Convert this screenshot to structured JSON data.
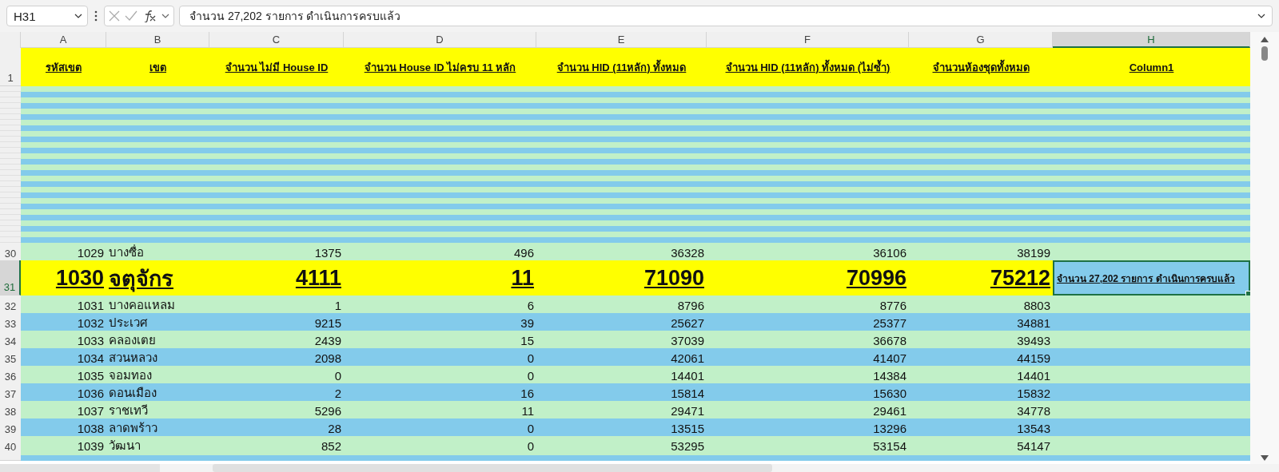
{
  "formula_bar": {
    "name_box": "H31",
    "formula": "จำนวน 27,202 รายการ ดำเนินการครบแล้ว"
  },
  "columns": [
    {
      "label": "A",
      "selected": false
    },
    {
      "label": "B",
      "selected": false
    },
    {
      "label": "C",
      "selected": false
    },
    {
      "label": "D",
      "selected": false
    },
    {
      "label": "E",
      "selected": false
    },
    {
      "label": "F",
      "selected": false
    },
    {
      "label": "G",
      "selected": false
    },
    {
      "label": "H",
      "selected": true
    }
  ],
  "header_row": {
    "number": "1",
    "color": "#ffff00",
    "cells": [
      "รหัสเขต",
      "เขต",
      "จำนวน ไม่มี House ID",
      "จำนวน House ID ไม่ครบ 11 หลัก",
      "จำนวน HID (11หลัก) ทั้งหมด",
      "จำนวน HID (11หลัก) ทั้งหมด (ไม่ซ้ำ)",
      "จำนวนห้องชุดทั้งหมด",
      "Column1"
    ]
  },
  "compressed_rows": [
    {
      "color": "#c1f0c8"
    },
    {
      "color": "#83cbeb"
    },
    {
      "color": "#c1f0c8"
    },
    {
      "color": "#83cbeb"
    },
    {
      "color": "#c1f0c8"
    },
    {
      "color": "#83cbeb"
    },
    {
      "color": "#c1f0c8"
    },
    {
      "color": "#83cbeb"
    },
    {
      "color": "#c1f0c8"
    },
    {
      "color": "#83cbeb"
    },
    {
      "color": "#c1f0c8"
    },
    {
      "color": "#83cbeb"
    },
    {
      "color": "#c1f0c8"
    },
    {
      "color": "#83cbeb"
    },
    {
      "color": "#c1f0c8"
    },
    {
      "color": "#83cbeb"
    },
    {
      "color": "#c1f0c8"
    },
    {
      "color": "#83cbeb"
    },
    {
      "color": "#c1f0c8"
    },
    {
      "color": "#83cbeb"
    },
    {
      "color": "#c1f0c8"
    },
    {
      "color": "#83cbeb"
    },
    {
      "color": "#c1f0c8"
    },
    {
      "color": "#83cbeb"
    },
    {
      "color": "#c1f0c8"
    },
    {
      "color": "#83cbeb"
    },
    {
      "color": "#c1f0c8"
    },
    {
      "color": "#83cbeb"
    }
  ],
  "rows": [
    {
      "number": "30",
      "kind": "normal",
      "selected": false,
      "color": "#c1f0c8",
      "cells": [
        "1029",
        "บางซื่อ",
        "1375",
        "496",
        "36328",
        "36106",
        "38199",
        ""
      ]
    },
    {
      "number": "31",
      "kind": "highlight",
      "selected": true,
      "color": "#ffff00",
      "cells": [
        "1030",
        "จตุจักร",
        "4111",
        "11",
        "71090",
        "70996",
        "75212",
        "จำนวน 27,202 รายการ ดำเนินการครบแล้ว"
      ]
    },
    {
      "number": "32",
      "kind": "normal",
      "selected": false,
      "color": "#c1f0c8",
      "cells": [
        "1031",
        "บางคอแหลม",
        "1",
        "6",
        "8796",
        "8776",
        "8803",
        ""
      ]
    },
    {
      "number": "33",
      "kind": "normal",
      "selected": false,
      "color": "#83cbeb",
      "cells": [
        "1032",
        "ประเวศ",
        "9215",
        "39",
        "25627",
        "25377",
        "34881",
        ""
      ]
    },
    {
      "number": "34",
      "kind": "normal",
      "selected": false,
      "color": "#c1f0c8",
      "cells": [
        "1033",
        "คลองเตย",
        "2439",
        "15",
        "37039",
        "36678",
        "39493",
        ""
      ]
    },
    {
      "number": "35",
      "kind": "normal",
      "selected": false,
      "color": "#83cbeb",
      "cells": [
        "1034",
        "สวนหลวง",
        "2098",
        "0",
        "42061",
        "41407",
        "44159",
        ""
      ]
    },
    {
      "number": "36",
      "kind": "normal",
      "selected": false,
      "color": "#c1f0c8",
      "cells": [
        "1035",
        "จอมทอง",
        "0",
        "0",
        "14401",
        "14384",
        "14401",
        ""
      ]
    },
    {
      "number": "37",
      "kind": "normal",
      "selected": false,
      "color": "#83cbeb",
      "cells": [
        "1036",
        "ดอนเมือง",
        "2",
        "16",
        "15814",
        "15630",
        "15832",
        ""
      ]
    },
    {
      "number": "38",
      "kind": "normal",
      "selected": false,
      "color": "#c1f0c8",
      "cells": [
        "1037",
        "ราชเทวี",
        "5296",
        "11",
        "29471",
        "29461",
        "34778",
        ""
      ]
    },
    {
      "number": "39",
      "kind": "normal",
      "selected": false,
      "color": "#83cbeb",
      "cells": [
        "1038",
        "ลาดพร้าว",
        "28",
        "0",
        "13515",
        "13296",
        "13543",
        ""
      ]
    },
    {
      "number": "40",
      "kind": "normal",
      "selected": false,
      "color": "#c1f0c8",
      "cells": [
        "1039",
        "วัฒนา",
        "852",
        "0",
        "53295",
        "53154",
        "54147",
        ""
      ]
    }
  ],
  "partial_row": {
    "color": "#83cbeb"
  }
}
